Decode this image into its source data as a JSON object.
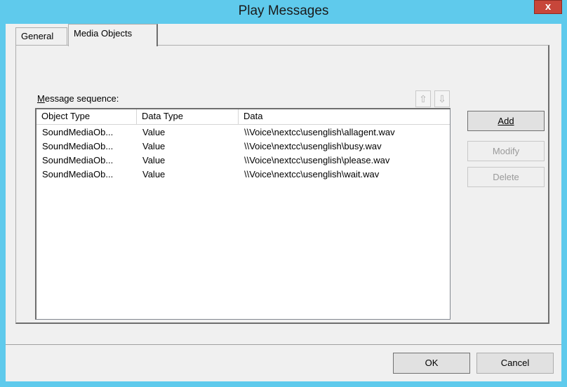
{
  "window": {
    "title": "Play Messages",
    "close_label": "x"
  },
  "tabs": [
    {
      "label": "General"
    },
    {
      "label": "Media Objects"
    }
  ],
  "sequence": {
    "label_prefix": "M",
    "label_rest": "essage sequence:",
    "move_up_icon": "move-up-arrow",
    "move_down_icon": "move-down-arrow"
  },
  "table": {
    "columns": [
      "Object Type",
      "Data Type",
      "Data"
    ],
    "rows": [
      [
        "SoundMediaOb...",
        "Value",
        "\\\\Voice\\nextcc\\usenglish\\allagent.wav"
      ],
      [
        "SoundMediaOb...",
        "Value",
        "\\\\Voice\\nextcc\\usenglish\\busy.wav"
      ],
      [
        "SoundMediaOb...",
        "Value",
        "\\\\Voice\\nextcc\\usenglish\\please.wav"
      ],
      [
        "SoundMediaOb...",
        "Value",
        "\\\\Voice\\nextcc\\usenglish\\wait.wav"
      ]
    ]
  },
  "buttons": {
    "add": {
      "label": "Add",
      "enabled": true
    },
    "modify": {
      "label": "Modify",
      "enabled": false
    },
    "delete": {
      "label": "Delete",
      "enabled": false
    },
    "ok": {
      "label": "OK"
    },
    "cancel": {
      "label": "Cancel"
    }
  },
  "colors": {
    "titlebar": "#5fcaec",
    "close": "#c7463a",
    "dialog": "#f0f0f0"
  }
}
